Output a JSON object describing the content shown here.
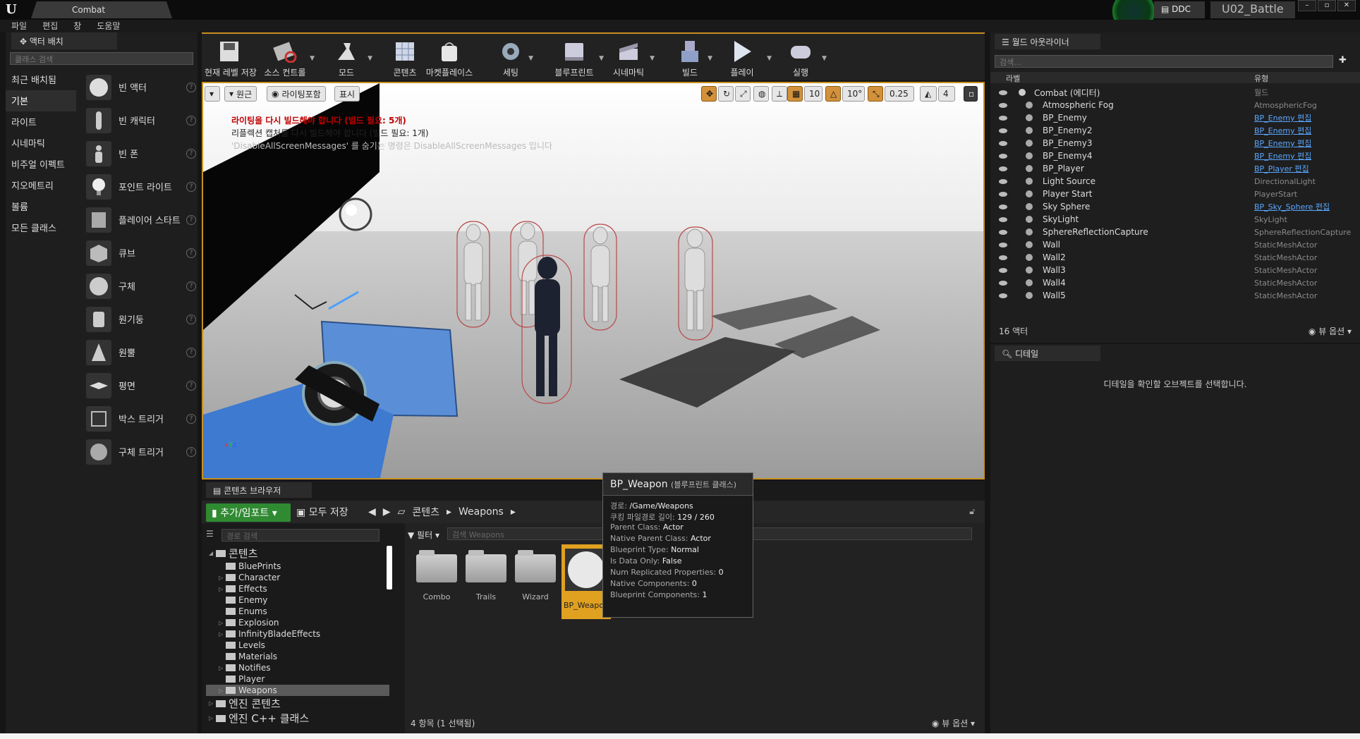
{
  "titlebar": {
    "doc_tab": "Combat",
    "ddc": "DDC",
    "project": "U02_Battle",
    "win": [
      "–",
      "▫",
      "✕"
    ]
  },
  "menu": [
    "파일",
    "편집",
    "창",
    "도움말"
  ],
  "placement": {
    "tab": "액터 배치",
    "search_placeholder": "클래스 검색",
    "categories": [
      "최근 배치됨",
      "기본",
      "라이트",
      "시네마틱",
      "비주얼 이펙트",
      "지오메트리",
      "볼륨",
      "모든 클래스"
    ],
    "active_category": 1,
    "items": [
      "빈 액터",
      "빈 캐릭터",
      "빈 폰",
      "포인트 라이트",
      "플레이어 스타트",
      "큐브",
      "구체",
      "원기둥",
      "원뿔",
      "평면",
      "박스 트리거",
      "구체 트리거"
    ]
  },
  "toolbar": {
    "buttons": [
      "현재 레벨 저장",
      "소스 컨트롤",
      "모드",
      "콘텐츠",
      "마켓플레이스",
      "세팅",
      "블루프린트",
      "시네마틱",
      "빌드",
      "플레이",
      "실행"
    ]
  },
  "viewport": {
    "btn_perspective": "원근",
    "btn_lighting": "라이팅포함",
    "btn_show": "표시",
    "grid": "10",
    "rotation": "10°",
    "scale": "0.25",
    "camera_speed": "4",
    "msg_lighting": "라이팅을 다시 빌드해야 합니다 (빌드 필요: 5개)",
    "msg_reflection": "리플렉션 캡처를 다시 빌드해야 합니다 (빌드 필요: 1개)",
    "msg_hint": "'DisableAllScreenMessages' 를 숨기는 명령은 DisableAllScreenMessages 입니다"
  },
  "content_browser": {
    "tab": "콘텐츠 브라우저",
    "add_import": "추가/임포트",
    "save_all": "모두 저장",
    "crumb_root": "콘텐츠",
    "crumb_folder": "Weapons",
    "path_search_placeholder": "경로 검색",
    "filter": "필터",
    "asset_search_placeholder": "검색 Weapons",
    "tree": [
      {
        "label": "콘텐츠",
        "level": 0,
        "big": true
      },
      {
        "label": "BluePrints",
        "level": 1
      },
      {
        "label": "Character",
        "level": 1
      },
      {
        "label": "Effects",
        "level": 1
      },
      {
        "label": "Enemy",
        "level": 1
      },
      {
        "label": "Enums",
        "level": 1
      },
      {
        "label": "Explosion",
        "level": 1
      },
      {
        "label": "InfinityBladeEffects",
        "level": 1
      },
      {
        "label": "Levels",
        "level": 1
      },
      {
        "label": "Materials",
        "level": 1
      },
      {
        "label": "Notifies",
        "level": 1
      },
      {
        "label": "Player",
        "level": 1
      },
      {
        "label": "Weapons",
        "level": 1,
        "selected": true
      },
      {
        "label": "엔진 콘텐츠",
        "level": 0,
        "big": true
      },
      {
        "label": "엔진 C++ 클래스",
        "level": 0,
        "big": true
      }
    ],
    "assets": [
      "Combo",
      "Trails",
      "Wizard",
      "BP_Weapon"
    ],
    "count": "4 항목 (1 선택됨)",
    "view_options": "뷰 옵션"
  },
  "tooltip": {
    "title": "BP_Weapon",
    "subtitle": "(블루프린트 클래스)",
    "rows": [
      {
        "k": "경로:",
        "v": "/Game/Weapons"
      },
      {
        "k": "쿠킹 파일경로 길이:",
        "v": "129 / 260"
      },
      {
        "k": "Parent Class:",
        "v": "Actor"
      },
      {
        "k": "Native Parent Class:",
        "v": "Actor"
      },
      {
        "k": "Blueprint Type:",
        "v": "Normal"
      },
      {
        "k": "Is Data Only:",
        "v": "False"
      },
      {
        "k": "Num Replicated Properties:",
        "v": "0"
      },
      {
        "k": "Native Components:",
        "v": "0"
      },
      {
        "k": "Blueprint Components:",
        "v": "1"
      }
    ]
  },
  "outliner": {
    "tab": "월드 아웃라이너",
    "search_placeholder": "검색...",
    "col_label": "라벨",
    "col_type": "유형",
    "rows": [
      {
        "name": "Combat (에디터)",
        "type": "월드",
        "link": false
      },
      {
        "name": "Atmospheric Fog",
        "type": "AtmosphericFog",
        "link": false
      },
      {
        "name": "BP_Enemy",
        "type": "BP_Enemy 편집",
        "link": true
      },
      {
        "name": "BP_Enemy2",
        "type": "BP_Enemy 편집",
        "link": true
      },
      {
        "name": "BP_Enemy3",
        "type": "BP_Enemy 편집",
        "link": true
      },
      {
        "name": "BP_Enemy4",
        "type": "BP_Enemy 편집",
        "link": true
      },
      {
        "name": "BP_Player",
        "type": "BP_Player 편집",
        "link": true
      },
      {
        "name": "Light Source",
        "type": "DirectionalLight",
        "link": false
      },
      {
        "name": "Player Start",
        "type": "PlayerStart",
        "link": false
      },
      {
        "name": "Sky Sphere",
        "type": "BP_Sky_Sphere 편집",
        "link": true
      },
      {
        "name": "SkyLight",
        "type": "SkyLight",
        "link": false
      },
      {
        "name": "SphereReflectionCapture",
        "type": "SphereReflectionCapture",
        "link": false
      },
      {
        "name": "Wall",
        "type": "StaticMeshActor",
        "link": false
      },
      {
        "name": "Wall2",
        "type": "StaticMeshActor",
        "link": false
      },
      {
        "name": "Wall3",
        "type": "StaticMeshActor",
        "link": false
      },
      {
        "name": "Wall4",
        "type": "StaticMeshActor",
        "link": false
      },
      {
        "name": "Wall5",
        "type": "StaticMeshActor",
        "link": false
      }
    ],
    "count": "16 액터",
    "view_options": "뷰 옵션"
  },
  "details": {
    "tab": "디테일",
    "message": "디테일을 확인할 오브젝트를 선택합니다."
  },
  "colors": {
    "accent": "#c8901e",
    "add_button": "#2f8a32",
    "link": "#5aa7ff",
    "selected_asset": "#e0a020"
  }
}
